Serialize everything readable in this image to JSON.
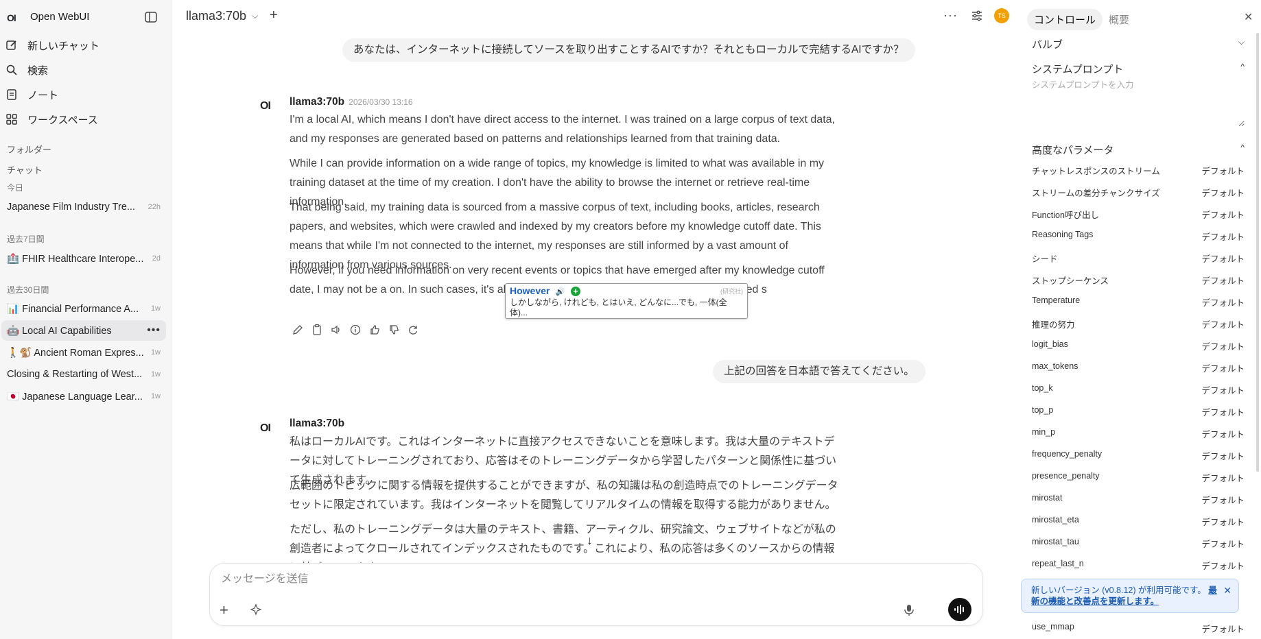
{
  "app": {
    "logo": "OI",
    "title": "Open WebUI"
  },
  "nav": [
    {
      "label": "新しいチャット"
    },
    {
      "label": "検索"
    },
    {
      "label": "ノート"
    },
    {
      "label": "ワークスペース"
    }
  ],
  "sidebar": {
    "folders_label": "フォルダー",
    "chats_label": "チャット",
    "groups": [
      {
        "label": "今日",
        "items": [
          {
            "title": "Japanese Film Industry Tre...",
            "ago": "22h"
          }
        ]
      },
      {
        "label": "過去7日間",
        "items": [
          {
            "title": "🏥 FHIR Healthcare Interope...",
            "ago": "2d"
          }
        ]
      },
      {
        "label": "過去30日間",
        "items": [
          {
            "title": "📊 Financial Performance A...",
            "ago": "1w"
          },
          {
            "title": "🤖 Local AI Capabilities",
            "ago": "",
            "more": "•••"
          },
          {
            "title": "🚶🐒 Ancient Roman Expres...",
            "ago": "1w"
          },
          {
            "title": "Closing & Restarting of West...",
            "ago": "1w"
          },
          {
            "title": "🇯🇵 Japanese Language Lear...",
            "ago": "1w"
          }
        ]
      }
    ]
  },
  "header": {
    "model": "llama3:70b",
    "avatar": "TS",
    "more": "···"
  },
  "chat": {
    "user1": "あなたは、インターネットに接続してソースを取り出すことするAIですか？それともローカルで完結するAIですか？",
    "bot1": {
      "logo": "OI",
      "name": "llama3:70b",
      "time": "2026/03/30 13:16",
      "paras": [
        "I'm a local AI, which means I don't have direct access to the internet. I was trained on a large corpus of text data, and my responses are generated based on patterns and relationships learned from that training data.",
        "While I can provide information on a wide range of topics, my knowledge is limited to what was available in my training dataset at the time of my creation. I don't have the ability to browse the internet or retrieve real-time information.",
        "That being said, my training data is sourced from a massive corpus of text, including books, articles, research papers, and websites, which were crawled and indexed by my creators before my knowledge cutoff date. This means that while I'm not connected to the internet, my responses are still informed by a vast amount of information from various sources.",
        "However, if you need information on very recent events or topics that have emerged after my knowledge cutoff date, I may not be a                                                                   on. In such cases, it's always best to verify information through other trusted s"
      ]
    },
    "user2": "上記の回答を日本語で答えてください。",
    "bot2": {
      "logo": "OI",
      "name": "llama3:70b",
      "paras": [
        "私はローカルAIです。これはインターネットに直接アクセスできないことを意味します。我は大量のテキストデータに対してトレーニングされており、応答はそのトレーニングデータから学習したパターンと関係性に基づいて生成されます。",
        "広範囲のトピックに関する情報を提供することができますが、私の知識は私の創造時点でのトレーニングデータセットに限定されています。我はインターネットを閲覧してリアルタイムの情報を取得する能力がありません。",
        "ただし、私のトレーニングデータは大量のテキスト、書籍、アーティクル、研究論文、ウェブサイトなどが私の創造者によってクロールされてインデックスされたものです。これにより、私の応答は多くのソースからの情報に基づいています。"
      ]
    }
  },
  "dict": {
    "word": "However",
    "source": "(研究社)",
    "definition": "しかしながら, けれども, とはいえ, どんなに...でも, 一体(全体)..."
  },
  "composer": {
    "placeholder": "メッセージを送信"
  },
  "rpanel": {
    "tabs": [
      "コントロール",
      "概要"
    ],
    "valves": "バルブ",
    "system_prompt": "システムプロンプト",
    "system_placeholder": "システムプロンプトを入力",
    "advanced": "高度なパラメータ",
    "default_label": "デフォルト",
    "params": [
      "チャットレスポンスのストリーム",
      "ストリームの差分チャンクサイズ",
      "Function呼び出し",
      "Reasoning Tags",
      "シード",
      "ストップシーケンス",
      "Temperature",
      "推理の努力",
      "logit_bias",
      "max_tokens",
      "top_k",
      "top_p",
      "min_p",
      "frequency_penalty",
      "presence_penalty",
      "mirostat",
      "mirostat_eta",
      "mirostat_tau",
      "repeat_last_n"
    ],
    "last_param": "use_mmap"
  },
  "toast": {
    "text": "新しいバージョン (v0.8.12) が利用可能です。",
    "link": "最新の機能と改善点を更新します。"
  }
}
